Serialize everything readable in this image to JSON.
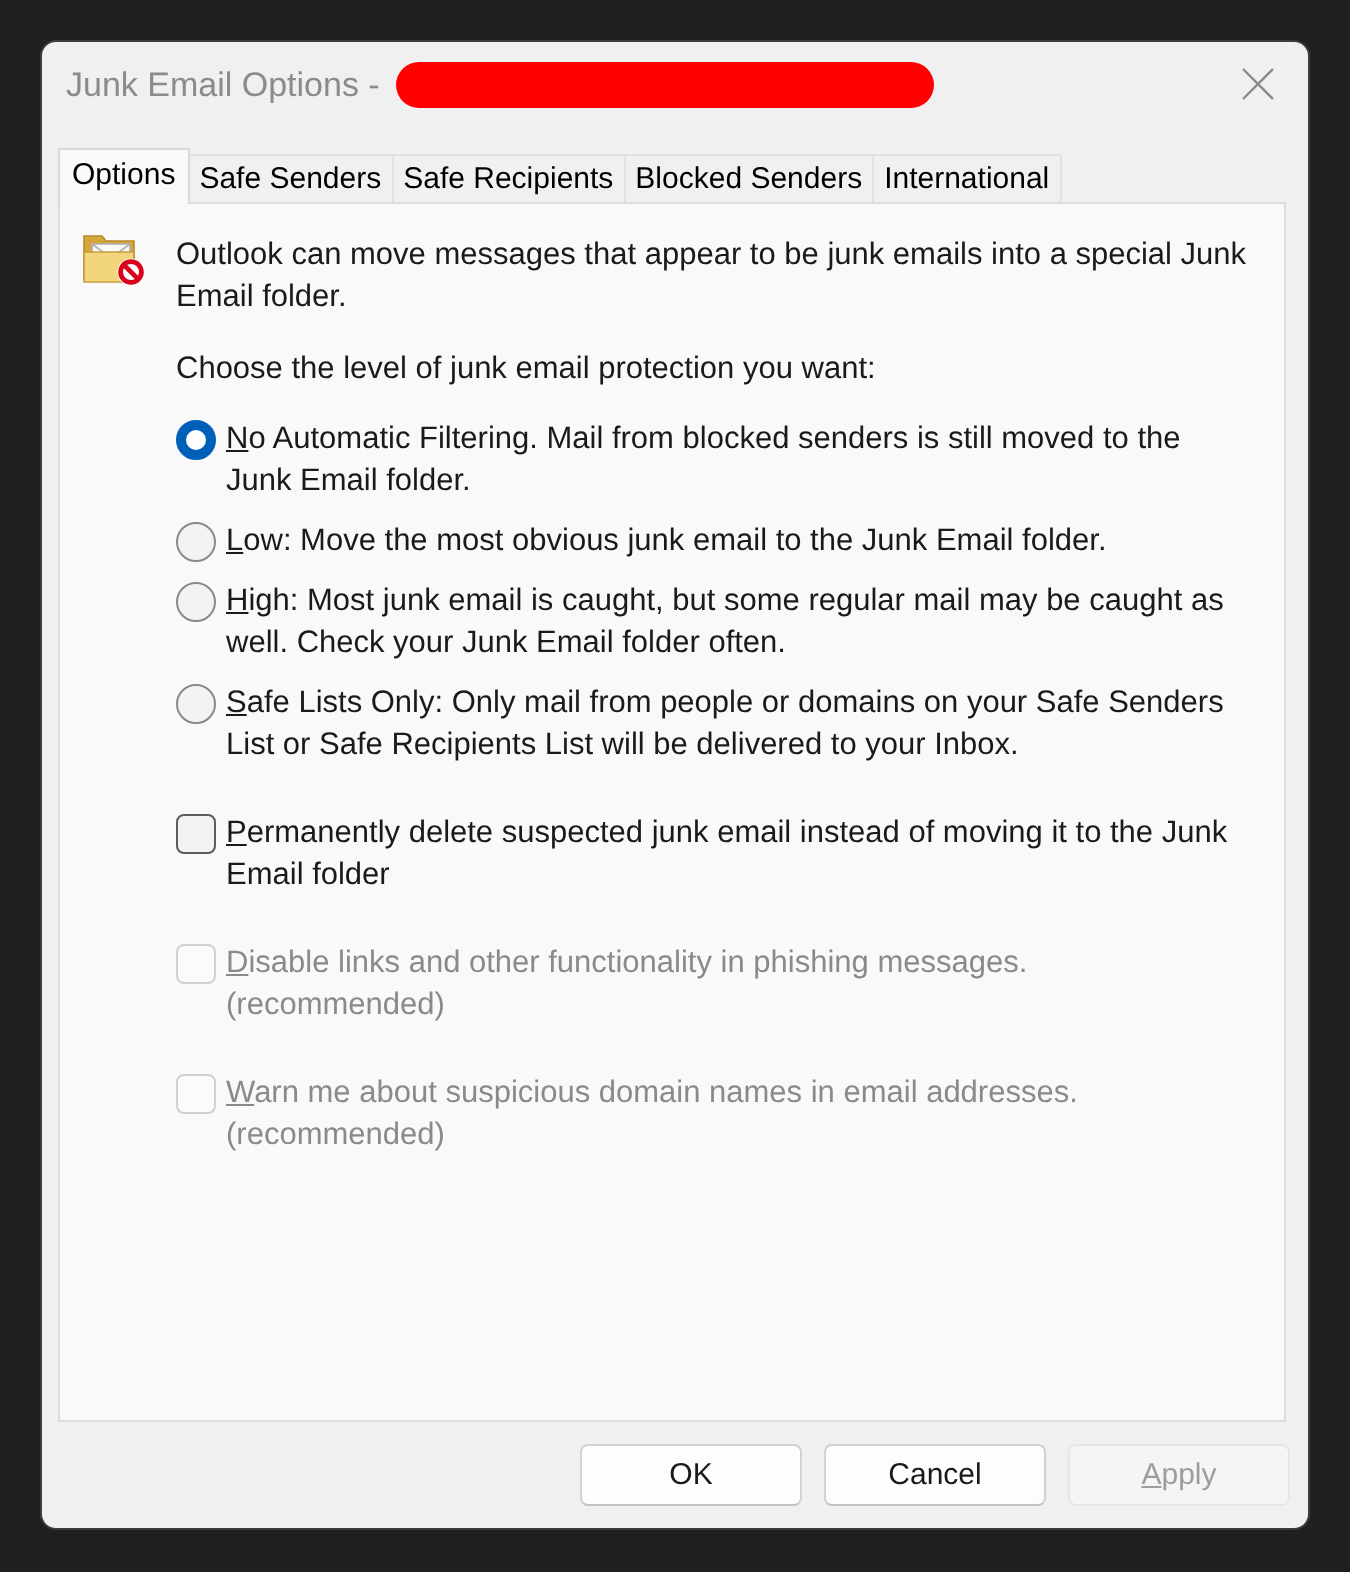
{
  "window": {
    "title": "Junk Email Options -",
    "title_redacted": true
  },
  "tabs": [
    {
      "label": "Options",
      "selected": true
    },
    {
      "label": "Safe Senders",
      "selected": false
    },
    {
      "label": "Safe Recipients",
      "selected": false
    },
    {
      "label": "Blocked Senders",
      "selected": false
    },
    {
      "label": "International",
      "selected": false
    }
  ],
  "intro": "Outlook can move messages that appear to be junk emails into a special Junk Email folder.",
  "prompt": "Choose the level of junk email protection you want:",
  "protection_levels": [
    {
      "label": "No Automatic Filtering. Mail from blocked senders is still moved to the Junk Email folder.",
      "access_key_underlined": true,
      "selected": true
    },
    {
      "label": "Low: Move the most obvious junk email to the Junk Email folder.",
      "access_key_underlined": true,
      "selected": false
    },
    {
      "label": "High: Most junk email is caught, but some regular mail may be caught as well. Check your Junk Email folder often.",
      "access_key_underlined": true,
      "selected": false
    },
    {
      "label": "Safe Lists Only: Only mail from people or domains on your Safe Senders List or Safe Recipients List will be delivered to your Inbox.",
      "access_key_underlined": true,
      "selected": false
    }
  ],
  "options": [
    {
      "label": "Permanently delete suspected junk email instead of moving it to the Junk Email folder",
      "access_key_underlined": true,
      "checked": false,
      "disabled": false
    },
    {
      "label": "Disable links and other functionality in phishing messages. (recommended)",
      "access_key_underlined": true,
      "checked": false,
      "disabled": true
    },
    {
      "label": "Warn me about suspicious domain names in email addresses. (recommended)",
      "access_key_underlined": true,
      "checked": false,
      "disabled": true
    }
  ],
  "buttons": [
    {
      "label": "OK",
      "disabled": false
    },
    {
      "label": "Cancel",
      "disabled": false
    },
    {
      "label": "Apply",
      "access_key_underlined": true,
      "disabled": true
    }
  ]
}
